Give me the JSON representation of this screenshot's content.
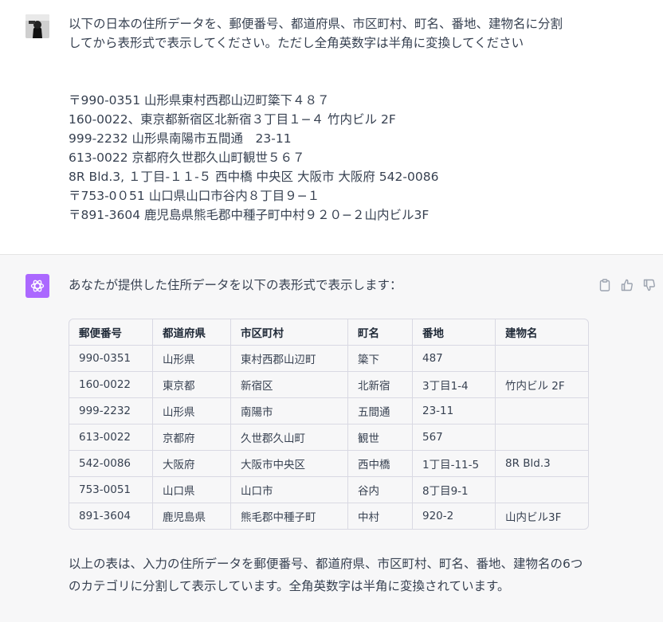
{
  "user_message": {
    "lines": [
      "以下の日本の住所データを、郵便番号、都道府県、市区町村、町名、番地、建物名に分割",
      "してから表形式で表示してください。ただし全角英数字は半角に変換してください"
    ],
    "address_lines": [
      "〒990-0351 山形県東村西郡山辺町簗下４８７",
      "160-0022、東京都新宿区北新宿３丁目１−４ 竹内ビル 2F",
      "999-2232 山形県南陽市五間通　23-11",
      "613-0022 京都府久世郡久山町観世５６７",
      "8R Bld.3, １丁目-１１-５ 西中橋 中央区 大阪市 大阪府 542-0086",
      "〒753-0０51 山口県山口市谷内８丁目９−１",
      "〒891-3604 鹿児島県熊毛郡中種子町中村９２０−２山内ビル3F"
    ]
  },
  "assistant_message": {
    "intro": "あなたが提供した住所データを以下の表形式で表示します：",
    "table": {
      "headers": [
        "郵便番号",
        "都道府県",
        "市区町村",
        "町名",
        "番地",
        "建物名"
      ],
      "rows": [
        [
          "990-0351",
          "山形県",
          "東村西郡山辺町",
          "簗下",
          "487",
          ""
        ],
        [
          "160-0022",
          "東京都",
          "新宿区",
          "北新宿",
          "3丁目1-4",
          "竹内ビル 2F"
        ],
        [
          "999-2232",
          "山形県",
          "南陽市",
          "五間通",
          "23-11",
          ""
        ],
        [
          "613-0022",
          "京都府",
          "久世郡久山町",
          "観世",
          "567",
          ""
        ],
        [
          "542-0086",
          "大阪府",
          "大阪市中央区",
          "西中橋",
          "1丁目-11-5",
          "8R Bld.3"
        ],
        [
          "753-0051",
          "山口県",
          "山口市",
          "谷内",
          "8丁目9-1",
          ""
        ],
        [
          "891-3604",
          "鹿児島県",
          "熊毛郡中種子町",
          "中村",
          "920-2",
          "山内ビル3F"
        ]
      ]
    },
    "outro": "以上の表は、入力の住所データを郵便番号、都道府県、市区町村、町名、番地、建物名の6つのカテゴリに分割して表示しています。全角英数字は半角に変換されています。"
  },
  "icons": {
    "assistant_avatar": "openai-logo-icon",
    "copy": "clipboard-icon",
    "like": "thumbs-up-icon",
    "dislike": "thumbs-down-icon"
  },
  "colors": {
    "assistant_avatar_bg": "#ab68ff",
    "assistant_bg": "#f7f7f8",
    "text": "#374151"
  }
}
